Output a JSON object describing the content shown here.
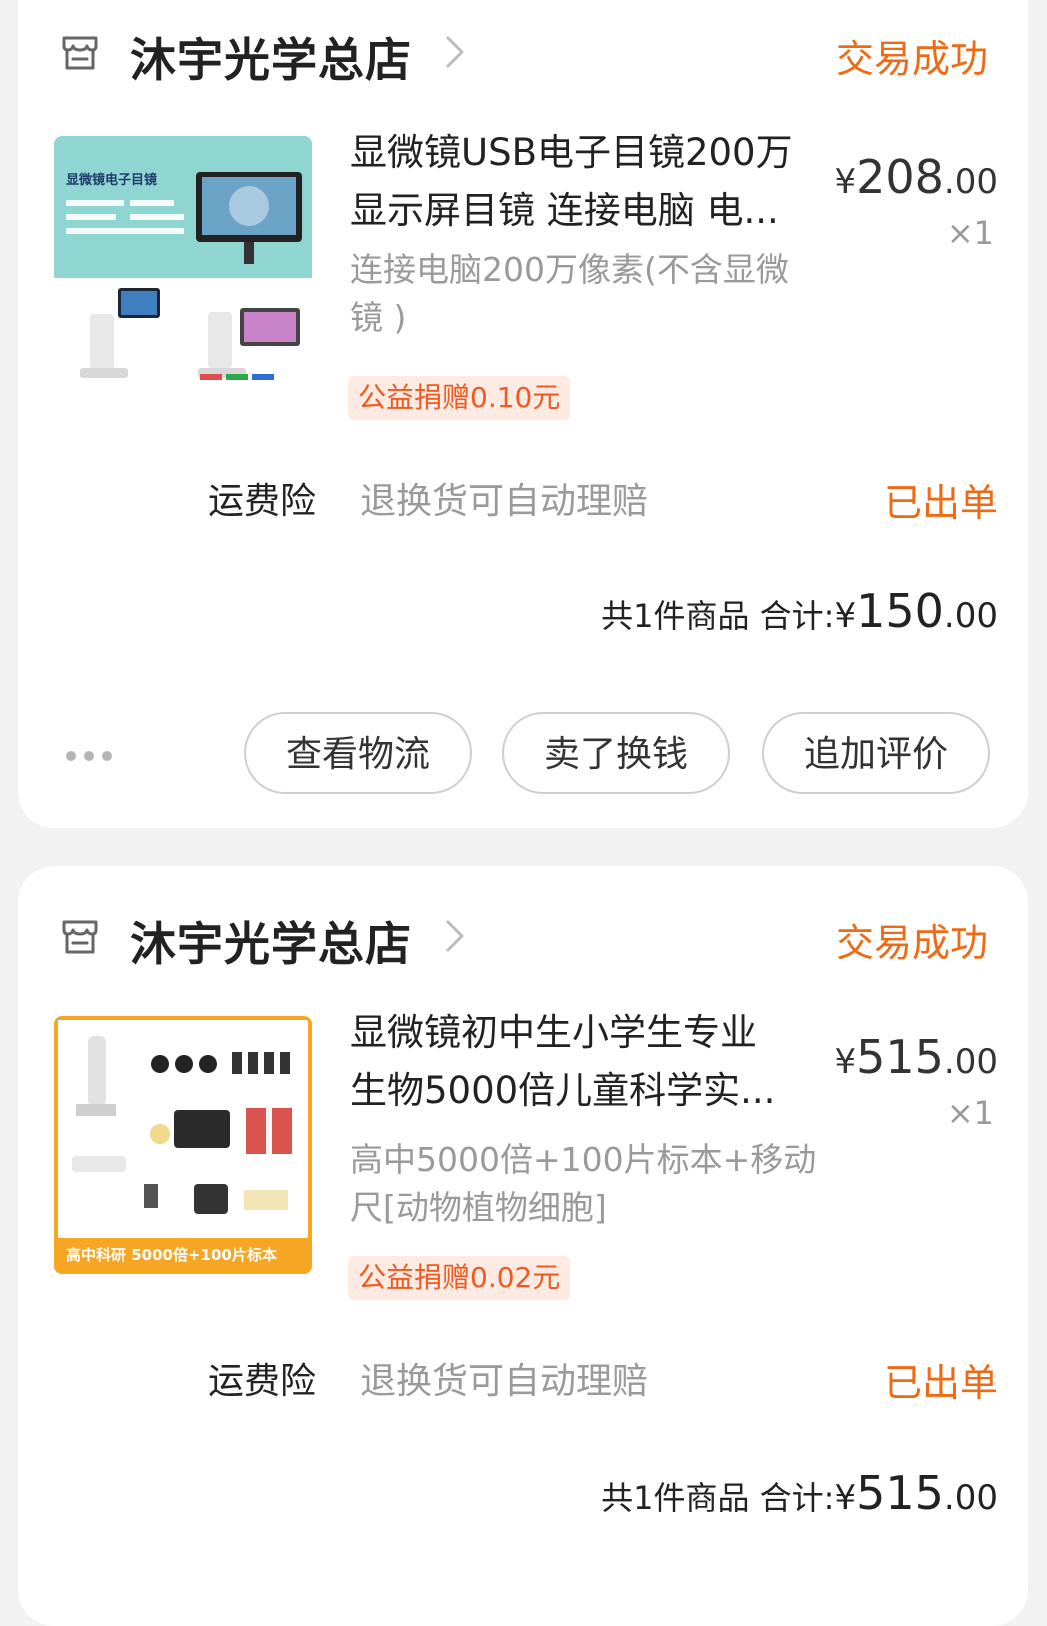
{
  "orders": [
    {
      "store_name": "沐宇光学总店",
      "status": "交易成功",
      "product": {
        "title_line1": "显微镜USB电子目镜200万",
        "title_line2": "显示屏目镜 连接电脑 电...",
        "spec_line1": "连接电脑200万像素(不含显微",
        "spec_line2": "镜 )",
        "badge": "公益捐赠0.10元",
        "price_symbol": "¥",
        "price_int": "208",
        "price_dec": ".00",
        "qty": "×1",
        "thumb_caption": "显微镜电子目镜"
      },
      "insurance": {
        "label": "运费险",
        "desc": "退换货可自动理赔",
        "status": "已出单"
      },
      "summary": {
        "text": "共1件商品 合计:",
        "symbol": "¥",
        "int": "150",
        "dec": ".00"
      },
      "actions": [
        "查看物流",
        "卖了换钱",
        "追加评价"
      ]
    },
    {
      "store_name": "沐宇光学总店",
      "status": "交易成功",
      "product": {
        "title_line1": "显微镜初中生小学生专业",
        "title_line2": "生物5000倍儿童科学实...",
        "spec_line1": "高中5000倍+100片标本+移动",
        "spec_line2": "尺[动物植物细胞]",
        "badge": "公益捐赠0.02元",
        "price_symbol": "¥",
        "price_int": "515",
        "price_dec": ".00",
        "qty": "×1",
        "thumb_caption": "高中科研 5000倍+100片标本"
      },
      "insurance": {
        "label": "运费险",
        "desc": "退换货可自动理赔",
        "status": "已出单"
      },
      "summary": {
        "text": "共1件商品 合计:",
        "symbol": "¥",
        "int": "515",
        "dec": ".00"
      }
    }
  ],
  "colors": {
    "accent": "#ee6a15",
    "badge_bg": "#fdebe3",
    "badge_text": "#ee5a20"
  },
  "icons": {
    "store": "store-icon",
    "more": "more-dots-icon",
    "chevron": "chevron-right-icon"
  }
}
